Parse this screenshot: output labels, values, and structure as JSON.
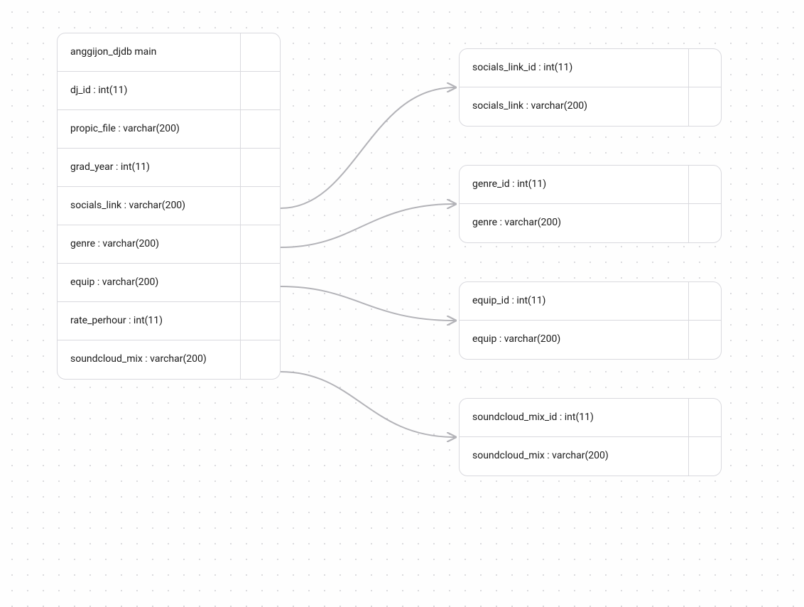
{
  "main_table": {
    "header": "anggijon_djdb main",
    "rows": [
      "dj_id : int(11)",
      "propic_file : varchar(200)",
      "grad_year : int(11)",
      "socials_link : varchar(200)",
      "genre : varchar(200)",
      "equip : varchar(200)",
      "rate_perhour : int(11)",
      "soundcloud_mix : varchar(200)"
    ]
  },
  "tables": {
    "socials": {
      "rows": [
        "socials_link_id : int(11)",
        "socials_link : varchar(200)"
      ]
    },
    "genre": {
      "rows": [
        "genre_id : int(11)",
        "genre : varchar(200)"
      ]
    },
    "equip": {
      "rows": [
        "equip_id : int(11)",
        "equip : varchar(200)"
      ]
    },
    "sound": {
      "rows": [
        "soundcloud_mix_id : int(11)",
        "soundcloud_mix : varchar(200)"
      ]
    }
  }
}
